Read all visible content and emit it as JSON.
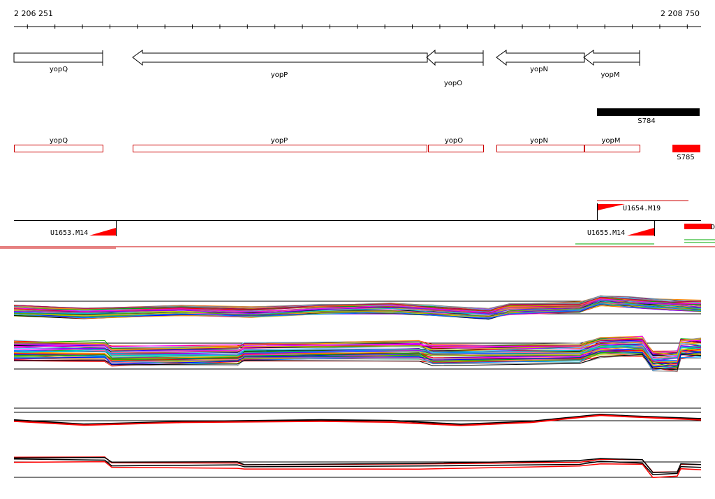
{
  "ruler": {
    "start_label": "2 206 251",
    "end_label": "2 208 750",
    "start": 2206251,
    "end": 2208750,
    "tick_step": 100
  },
  "colors": {
    "gene_outline": "#000000",
    "cds_outline": "#cc0000",
    "marker_red": "#ff0000",
    "region_black": "#000000",
    "probe_green": "#00aa00",
    "axis": "#000000"
  },
  "genes": [
    {
      "name": "yopQ",
      "start": 2206251,
      "end": 2206575,
      "strand": "+"
    },
    {
      "name": "yopP",
      "start": 2206680,
      "end": 2207740,
      "strand": "-"
    },
    {
      "name": "yopO",
      "start": 2207740,
      "end": 2207950,
      "strand": "-"
    },
    {
      "name": "yopN",
      "start": 2207995,
      "end": 2208315,
      "strand": "-"
    },
    {
      "name": "yopM",
      "start": 2208315,
      "end": 2208520,
      "strand": "-"
    }
  ],
  "regions": [
    {
      "name": "S784",
      "start": 2208375,
      "end": 2208750,
      "color": "#000000"
    },
    {
      "name": "S785",
      "start": 2208650,
      "end": 2208750,
      "color": "#ff0000"
    }
  ],
  "markers": [
    {
      "name": "U1653.M14"
    },
    {
      "name": "U1654.M19"
    },
    {
      "name": "U1655.M14"
    },
    {
      "name": "D"
    }
  ]
}
